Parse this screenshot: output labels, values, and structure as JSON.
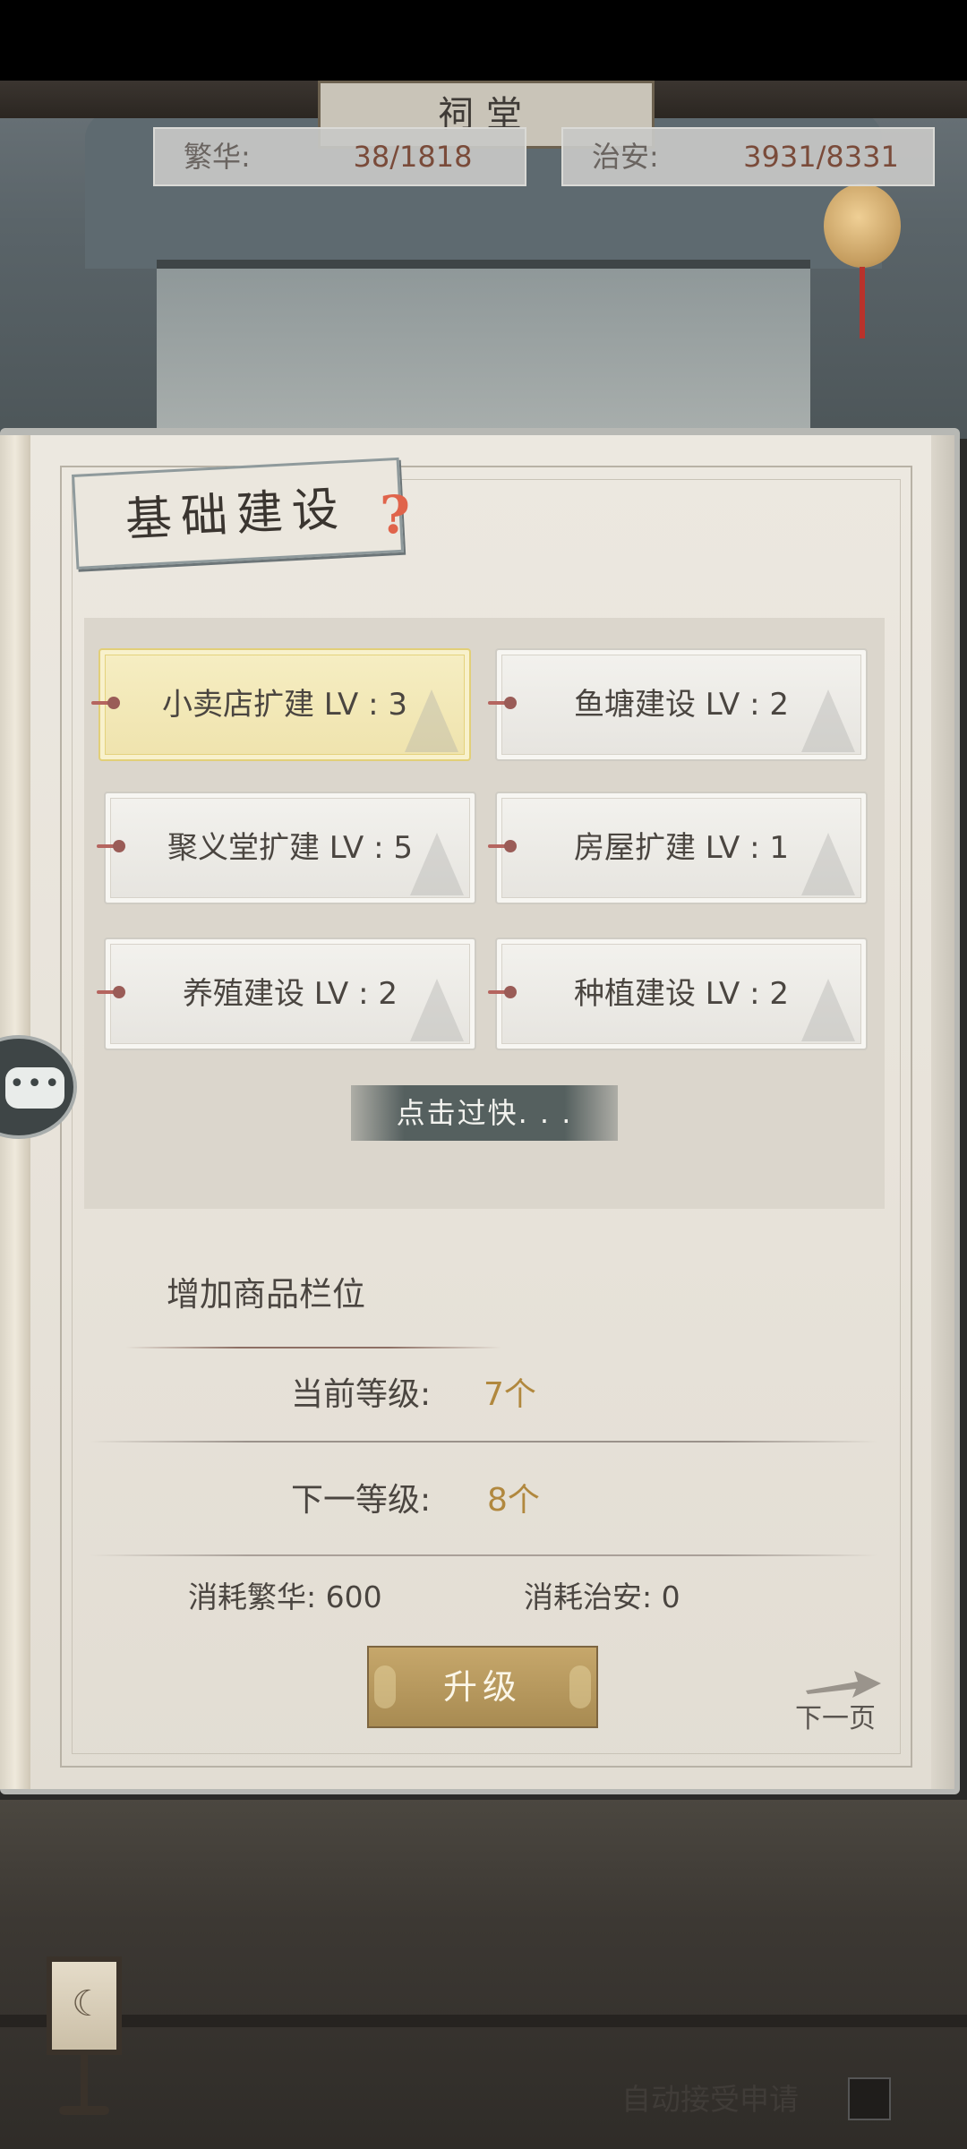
{
  "hud": {
    "hall_sign": "祠堂",
    "prosperity_label": "繁华:",
    "prosperity_value": "38/1818",
    "security_label": "治安:",
    "security_value": "3931/8331"
  },
  "panel": {
    "title": "基础建设",
    "help_icon": "question-mark-icon",
    "tiles": [
      {
        "label": "小卖店扩建 LV : 3",
        "selected": true
      },
      {
        "label": "鱼塘建设 LV : 2",
        "selected": false
      },
      {
        "label": "聚义堂扩建 LV : 5",
        "selected": false
      },
      {
        "label": "房屋扩建 LV : 1",
        "selected": false
      },
      {
        "label": "养殖建设 LV : 2",
        "selected": false
      },
      {
        "label": "种植建设 LV : 2",
        "selected": false
      }
    ],
    "toast": "点击过快. . .",
    "detail": {
      "title": "增加商品栏位",
      "current_label": "当前等级:",
      "current_value": "7个",
      "next_label": "下一等级:",
      "next_value": "8个",
      "cost_prosperity": "消耗繁华:  600",
      "cost_security": "消耗治安:  0"
    },
    "upgrade_label": "升级",
    "next_page_label": "下一页"
  },
  "footer": {
    "auto_accept_label": "自动接受申请",
    "auto_accept_checked": false
  },
  "colors": {
    "accent_gold": "#b1883e",
    "button_gold": "#c6a76b",
    "selected_tile": "#f6eec3",
    "help_red": "#e0644b"
  }
}
